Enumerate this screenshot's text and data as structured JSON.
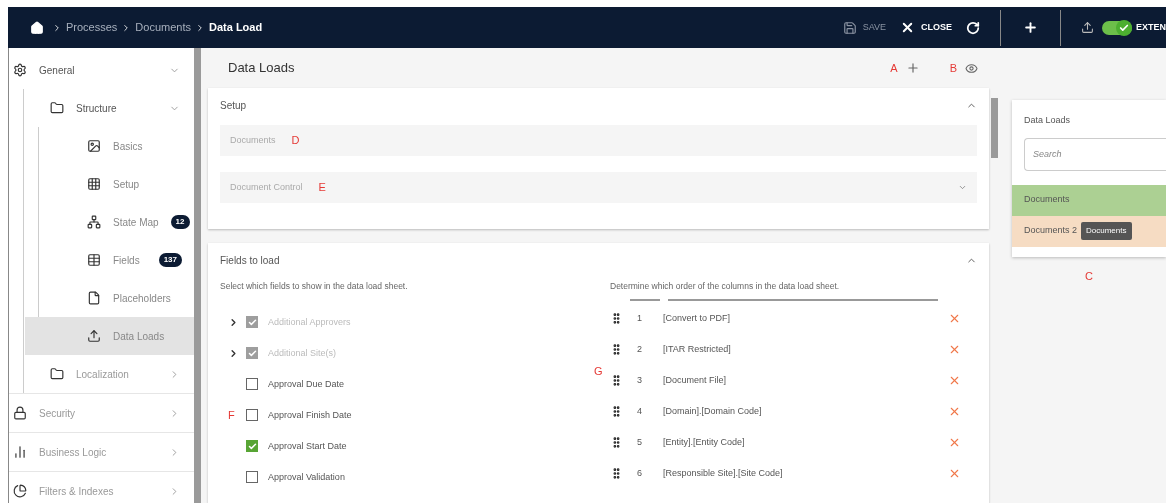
{
  "breadcrumb": [
    {
      "label": "Processes",
      "current": false
    },
    {
      "label": "Documents",
      "current": false
    },
    {
      "label": "Data Load",
      "current": true
    }
  ],
  "toolbar": {
    "save": {
      "label": "SAVE",
      "disabled": true
    },
    "close": {
      "label": "CLOSE",
      "disabled": false
    },
    "toggle": {
      "label": "EXTEN",
      "on": true
    }
  },
  "sidebar": {
    "items": [
      {
        "label": "General",
        "expanded": true,
        "selected": false,
        "children": [
          {
            "label": "Structure",
            "expanded": true,
            "selected": false,
            "children": [
              {
                "label": "Basics",
                "selected": false
              },
              {
                "label": "Setup",
                "selected": false
              },
              {
                "label": "State Map",
                "selected": false,
                "badge": "12"
              },
              {
                "label": "Fields",
                "selected": false,
                "badge": "137"
              },
              {
                "label": "Placeholders",
                "selected": false
              },
              {
                "label": "Data Loads",
                "selected": true
              }
            ]
          },
          {
            "label": "Localization",
            "expanded": false,
            "selected": false
          }
        ]
      },
      {
        "label": "Security",
        "expanded": false,
        "selected": false
      },
      {
        "label": "Business Logic",
        "expanded": false,
        "selected": false
      },
      {
        "label": "Filters & Indexes",
        "expanded": false,
        "selected": false
      }
    ]
  },
  "page": {
    "title": "Data Loads",
    "add_mark": "A",
    "view_mark": "B"
  },
  "setup": {
    "title": "Setup",
    "expanded": true,
    "fields": [
      {
        "kind": "text",
        "placeholder": "Documents",
        "mark": "D"
      },
      {
        "kind": "select",
        "placeholder": "Document Control",
        "mark": "E"
      }
    ]
  },
  "fields_to_load": {
    "title": "Fields to load",
    "expanded": true,
    "left_hint": "Select which fields to show in the data load sheet.",
    "right_hint": "Determine which order of the columns in the data load sheet.",
    "fields": [
      {
        "label": "Additional Approvers",
        "checked": true,
        "disabled": true,
        "expandable": true
      },
      {
        "label": "Additional Site(s)",
        "checked": true,
        "disabled": true,
        "expandable": true
      },
      {
        "label": "Approval Due Date",
        "checked": false,
        "disabled": false,
        "expandable": false
      },
      {
        "label": "Approval Finish Date",
        "checked": false,
        "disabled": false,
        "expandable": false,
        "mark": "F"
      },
      {
        "label": "Approval Start Date",
        "checked": true,
        "disabled": false,
        "expandable": false
      },
      {
        "label": "Approval Validation",
        "checked": false,
        "disabled": false,
        "expandable": false
      }
    ],
    "order_mark": "G",
    "order": [
      {
        "number": "1",
        "name": "[Convert to PDF]"
      },
      {
        "number": "2",
        "name": "[ITAR Restricted]"
      },
      {
        "number": "3",
        "name": "[Document File]"
      },
      {
        "number": "4",
        "name": "[Domain].[Domain Code]"
      },
      {
        "number": "5",
        "name": "[Entity].[Entity Code]"
      },
      {
        "number": "6",
        "name": "[Responsible Site].[Site Code]"
      }
    ]
  },
  "right_panel": {
    "title": "Data Loads",
    "search": {
      "placeholder": "Search"
    },
    "mark": "C",
    "items": [
      {
        "label": "Documents",
        "color": "#acd093"
      },
      {
        "label": "Documents 2",
        "color": "#f6dcc3",
        "tooltip": "Documents"
      }
    ]
  }
}
